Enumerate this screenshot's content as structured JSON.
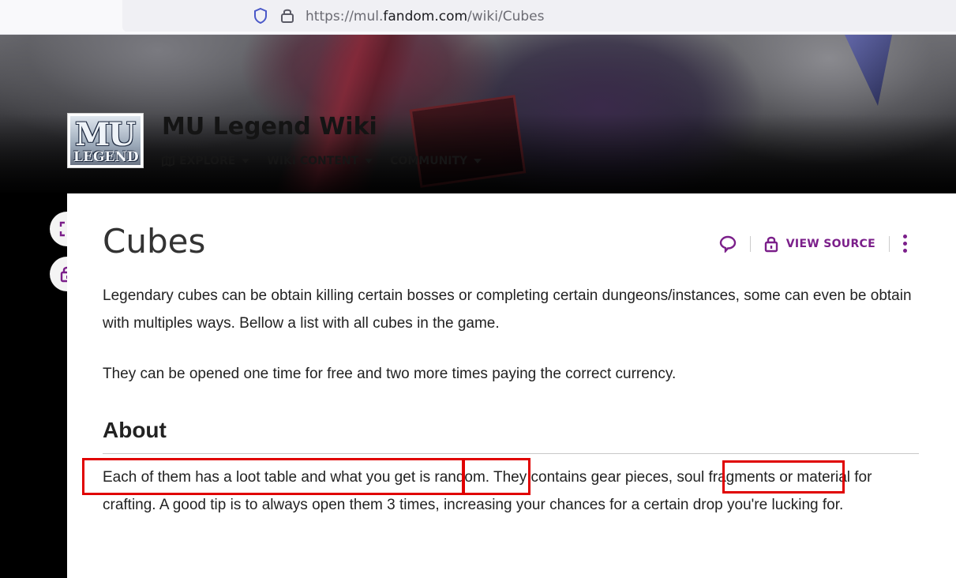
{
  "browser": {
    "url_prefix": "https://mul.",
    "url_domain": "fandom.com",
    "url_path": "/wiki/Cubes"
  },
  "wiki": {
    "title": "MU Legend Wiki",
    "logo_top": "MU",
    "logo_bottom": "LEGEND",
    "nav": [
      {
        "label": "EXPLORE",
        "icon": "compass-icon"
      },
      {
        "label": "WIKI CONTENT"
      },
      {
        "label": "COMMUNITY"
      }
    ]
  },
  "article": {
    "title": "Cubes",
    "view_source_label": "VIEW SOURCE",
    "intro_paragraph": "Legendary cubes can be obtain killing certain bosses or completing certain dungeons/instances, some can even be obtain with multiples ways. Bellow a list with all cubes in the game.",
    "second_paragraph": "They can be opened one time for free and two more times paying the correct currency.",
    "section_heading": "About",
    "about_paragraph": "Each of them has a loot table and what you get is random. They contains gear pieces, soul fragments or material for crafting. A good tip is to always open them 3 times, increasing your chances for a certain drop you're lucking for."
  },
  "highlights": [
    "Each of them has a loot table and what you get is",
    "random.",
    "soul fragments"
  ],
  "colors": {
    "accent": "#7b1f8a",
    "highlight": "#e00000"
  }
}
